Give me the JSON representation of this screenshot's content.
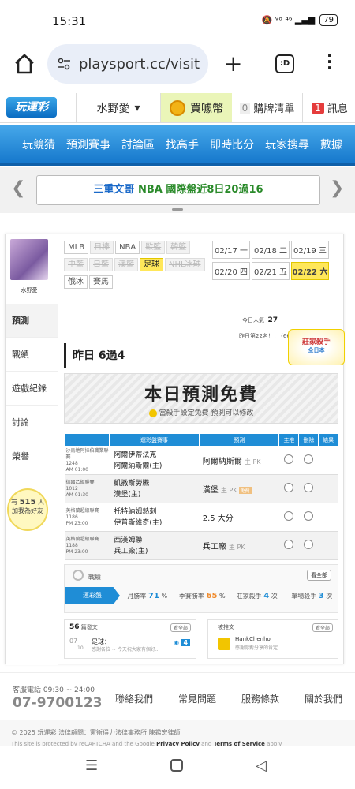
{
  "status_bar": {
    "time": "15:31",
    "icons": "🔕 ᵛᵒ ⁴⁶ ▂▄▆",
    "battery": "79"
  },
  "browser": {
    "url": "playsport.cc/visit",
    "tab_count": ":D"
  },
  "header": {
    "logo": "玩運彩",
    "user": "水野愛",
    "coin_label": "買噱幣",
    "cart_count": "0",
    "cart_label": "購牌清單",
    "msg_count": "1",
    "msg_label": "訊息"
  },
  "nav": [
    "玩競猜",
    "預測賽事",
    "討論區",
    "找高手",
    "即時比分",
    "玩家搜尋",
    "數據"
  ],
  "marquee": {
    "author": "三重文哥",
    "text": " NBA 國際盤近8日20過16"
  },
  "sidebar": {
    "name": "水野愛",
    "items": [
      "預測",
      "戰績",
      "遊戲紀錄",
      "討論",
      "榮譽"
    ],
    "bulb_prefix": "有",
    "bulb_count": "515",
    "bulb_suffix": "人",
    "bulb_text": "加我為好友"
  },
  "filters": [
    {
      "label": "MLB",
      "state": "normal"
    },
    {
      "label": "日棒",
      "state": "dis"
    },
    {
      "label": "NBA",
      "state": "normal"
    },
    {
      "label": "歐籃",
      "state": "dis"
    },
    {
      "label": "韓籃",
      "state": "dis"
    },
    {
      "label": "中籃",
      "state": "dis"
    },
    {
      "label": "日籃",
      "state": "dis"
    },
    {
      "label": "澳籃",
      "state": "dis"
    },
    {
      "label": "足球",
      "state": "sel"
    },
    {
      "label": "NHL冰球",
      "state": "dis"
    },
    {
      "label": "俄冰",
      "state": "normal"
    },
    {
      "label": "賽馬",
      "state": "normal"
    }
  ],
  "dates": [
    {
      "label": "02/17 一",
      "sel": false
    },
    {
      "label": "02/18 二",
      "sel": false
    },
    {
      "label": "02/19 三",
      "sel": false
    },
    {
      "label": "02/20 四",
      "sel": false
    },
    {
      "label": "02/21 五",
      "sel": false
    },
    {
      "label": "02/22 六",
      "sel": true
    }
  ],
  "stats": {
    "today_label": "今日人氣",
    "today_value": "27",
    "rank_text": "昨日第22名！！",
    "rank_sub": "(66974)"
  },
  "badge": {
    "line1": "莊家殺手",
    "line2": "全日本"
  },
  "yesterday": "昨日 6過4",
  "free": {
    "title": "本日預測免費",
    "subtitle": "當殺手設定免費  預測可以修改"
  },
  "table": {
    "headers": [
      "",
      "運彩盤賽事",
      "預測",
      "主推",
      "刪除",
      "結果"
    ],
    "rows": [
      {
        "league": "沙烏地阿拉伯職業聯賽",
        "code": "1248",
        "time": "AM 01:00",
        "home": "阿爾伊蒂法克",
        "away": "阿爾納斯爾(主)",
        "pick": "阿爾納斯爾",
        "pick_note": "主 PK",
        "chip": ""
      },
      {
        "league": "德國乙級聯賽",
        "code": "1012",
        "time": "AM 01:30",
        "home": "凱撒斯勞騰",
        "away": "漢堡(主)",
        "pick": "漢堡",
        "pick_note": "主 PK",
        "chip": "免費"
      },
      {
        "league": "英格蘭超級聯賽",
        "code": "1186",
        "time": "PM 23:00",
        "home": "托特納姆熱刺",
        "away": "伊普斯維奇(主)",
        "pick": "2.5 大分",
        "pick_note": "",
        "chip": ""
      },
      {
        "league": "英格蘭超級聯賽",
        "code": "1188",
        "time": "PM 23:00",
        "home": "西漢姆聯",
        "away": "兵工廠(主)",
        "pick": "兵工廠",
        "pick_note": "主 PK",
        "chip": ""
      }
    ]
  },
  "record": {
    "label": "戰績",
    "more": "看全部",
    "tab": "運彩盤",
    "cells": [
      {
        "label": "月勝率",
        "value": "71",
        "unit": "%"
      },
      {
        "label": "季賽勝率",
        "value": "65",
        "unit": "%"
      },
      {
        "label": "莊家殺手",
        "value": "4",
        "unit": "次"
      },
      {
        "label": "單場殺手",
        "value": "3",
        "unit": "次"
      }
    ]
  },
  "box_left": {
    "count": "56",
    "title": "篇發文",
    "more": "看全部",
    "date": "07",
    "sub_date": "10",
    "post": "足球：",
    "post_desc": "感謝各位 ~ 今天祝大家有個好...",
    "reply_count": "4"
  },
  "box_right": {
    "title": "被推文",
    "more": "看全部",
    "user": "HankChenho",
    "desc": "感謝你對分享的肯定"
  },
  "footer": {
    "service": "客服電話 09:30 ~ 24:00",
    "phone": "07-9700123",
    "links": [
      "聯絡我們",
      "常見問題",
      "服務條款",
      "關於我們"
    ]
  },
  "legal": {
    "copyright": "© 2025 玩運彩  法律顧問：憲衡得力法律事務所 陳鑑宏律師",
    "recaptcha": "This site is protected by reCAPTCHA and the Google ",
    "privacy": "Privacy Policy",
    "and": " and ",
    "terms": "Terms of Service",
    "apply": " apply."
  },
  "colors": {
    "nav_top": "#47a8ea",
    "nav_bottom": "#1678cc",
    "accent_yellow": "#ffe75a",
    "table_head": "#1f8dd6"
  }
}
